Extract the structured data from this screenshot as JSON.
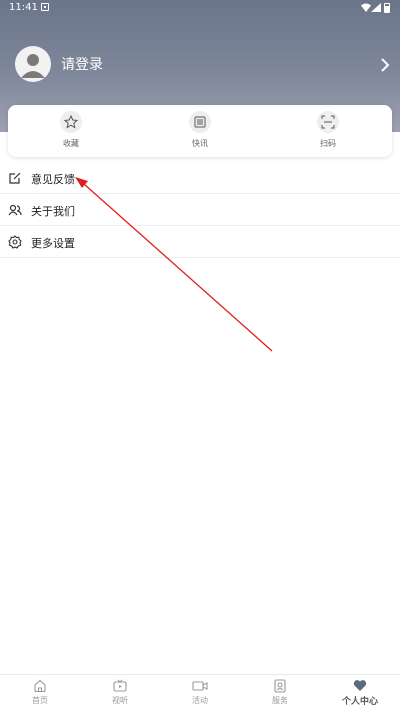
{
  "status_bar": {
    "time": "11:41"
  },
  "profile": {
    "login_text": "请登录"
  },
  "quick_actions": [
    {
      "label": "收藏",
      "icon": "star-icon"
    },
    {
      "label": "快讯",
      "icon": "news-list-icon"
    },
    {
      "label": "扫码",
      "icon": "scan-icon"
    }
  ],
  "menu": [
    {
      "label": "意见反馈",
      "icon": "edit-icon"
    },
    {
      "label": "关于我们",
      "icon": "users-icon"
    },
    {
      "label": "更多设置",
      "icon": "gear-icon"
    }
  ],
  "annotation": {
    "arrow_color": "#e0201c"
  },
  "bottom_nav": [
    {
      "label": "首页",
      "icon": "home-icon"
    },
    {
      "label": "视听",
      "icon": "tv-icon"
    },
    {
      "label": "活动",
      "icon": "video-camera-icon"
    },
    {
      "label": "服务",
      "icon": "service-icon"
    },
    {
      "label": "个人中心",
      "icon": "heart-icon",
      "active": true
    }
  ],
  "colors": {
    "header": "#7e879a",
    "active_nav": "#555555"
  }
}
